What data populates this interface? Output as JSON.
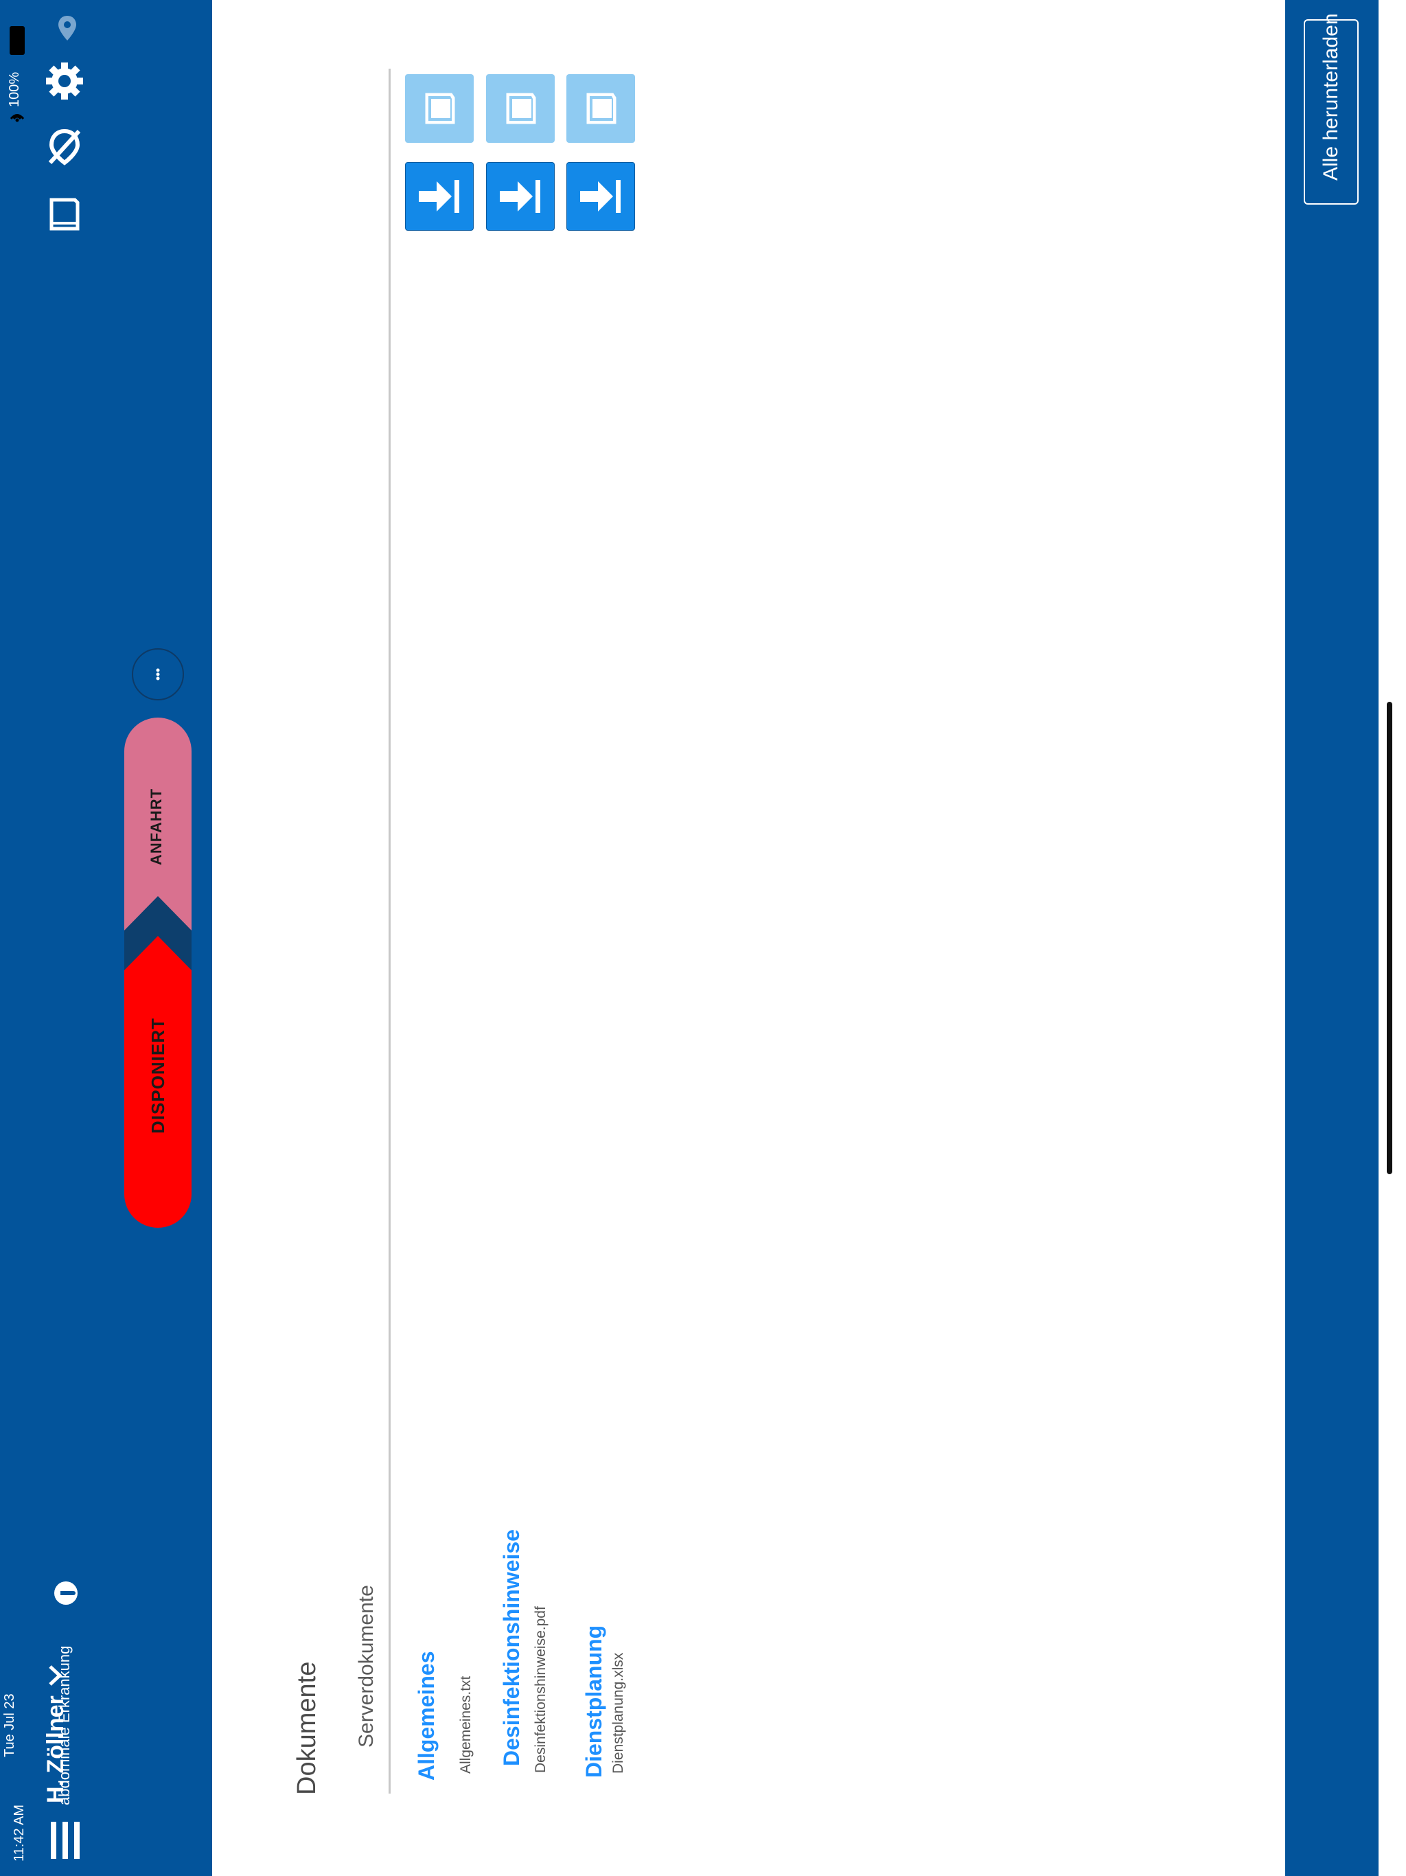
{
  "status_bar": {
    "time": "11:42 AM",
    "date": "Tue Jul 23",
    "battery": "100%"
  },
  "header": {
    "user_name": "H. Zöllner",
    "subtitle": "abdominale Erkrankung"
  },
  "status_pill": {
    "current": "DISPONIERT",
    "next": "ANFAHRT",
    "current_color": "#ff0000",
    "next_color": "#d9718f"
  },
  "documents": {
    "title": "Dokumente",
    "section": "Serverdokumente",
    "items": [
      {
        "name": "Allgemeines",
        "file": "Allgemeines.txt"
      },
      {
        "name": "Desinfektionshinweise",
        "file": "Desinfektionshinweise.pdf"
      },
      {
        "name": "Dienstplanung",
        "file": "Dienstplanung.xlsx"
      }
    ]
  },
  "toolbar": {
    "download_all": "Alle herunterladen"
  },
  "colors": {
    "primary": "#03549b",
    "link": "#1e90ff",
    "tile_light": "#8fcbf2",
    "tile_dark": "#1389e8"
  }
}
